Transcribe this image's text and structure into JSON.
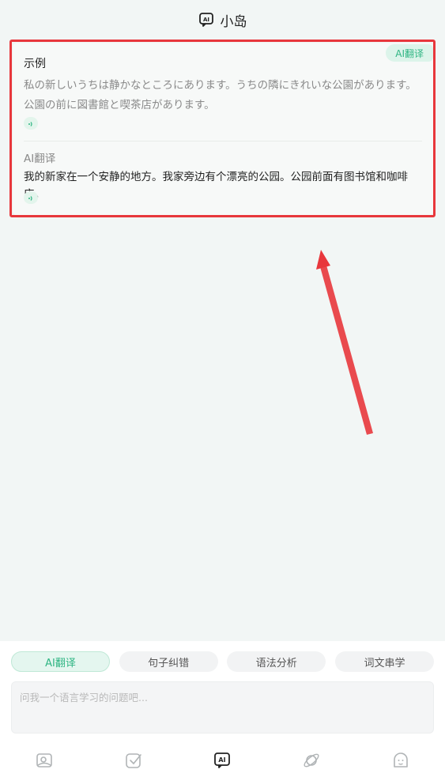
{
  "header": {
    "title": "小岛",
    "icon": "ai-chat-icon"
  },
  "card": {
    "badge": "AI翻译",
    "example_label": "示例",
    "japanese_text": " 私の新しいうちは静かなところにあります。うちの隣にきれいな公園があります。公園の前に図書館と喫茶店があります。",
    "translation_label": "AI翻译",
    "chinese_text": "我的新家在一个安静的地方。我家旁边有个漂亮的公园。公园前面有图书馆和咖啡店。"
  },
  "colors": {
    "accent": "#2fb583",
    "highlight": "#e8373c",
    "arrow": "#e8373c"
  },
  "chips": [
    {
      "label": "AI翻译",
      "active": true
    },
    {
      "label": "句子纠错",
      "active": false
    },
    {
      "label": "语法分析",
      "active": false
    },
    {
      "label": "词文串学",
      "active": false
    }
  ],
  "input": {
    "placeholder": "问我一个语言学习的问题吧...",
    "value": ""
  },
  "tabbar": [
    "photo-icon",
    "checkbox-icon",
    "ai-chat-icon",
    "planet-icon",
    "face-icon"
  ]
}
